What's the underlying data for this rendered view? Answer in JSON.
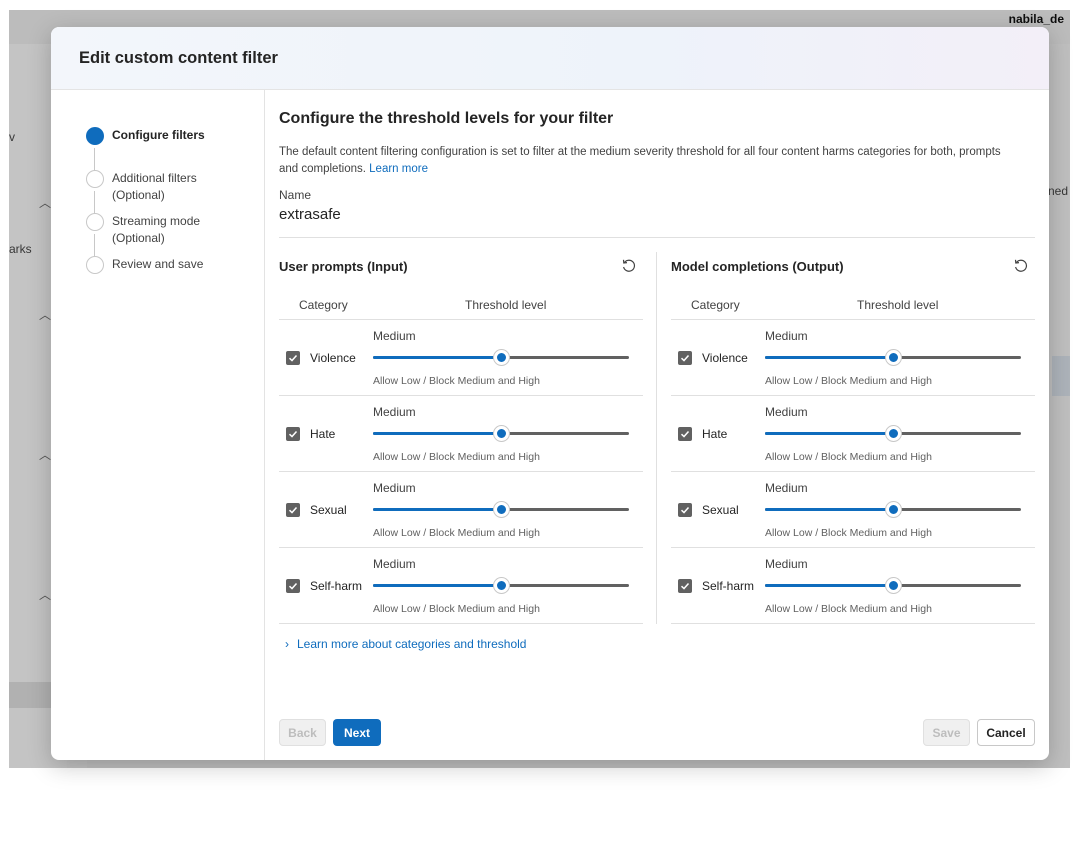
{
  "background": {
    "user": "nabila_de",
    "fragments": [
      "v",
      "arks",
      "ned"
    ]
  },
  "dialog": {
    "title": "Edit custom content filter"
  },
  "steps": [
    {
      "label": "Configure filters",
      "active": true
    },
    {
      "label": "Additional filters (Optional)",
      "active": false
    },
    {
      "label": "Streaming mode (Optional)",
      "active": false
    },
    {
      "label": "Review and save",
      "active": false
    }
  ],
  "main": {
    "heading": "Configure the threshold levels for your filter",
    "description": "The default content filtering configuration is set to filter at the medium severity threshold for all four content harms categories for both, prompts and completions.",
    "learn_more": "Learn more",
    "name_label": "Name",
    "name_value": "extrasafe",
    "more_link": "Learn more about categories and threshold"
  },
  "panels": [
    {
      "title": "User prompts (Input)",
      "col_category": "Category",
      "col_threshold": "Threshold level",
      "rows": [
        {
          "category": "Violence",
          "checked": true,
          "level": "Medium",
          "hint": "Allow Low / Block Medium and High",
          "value": 0.5
        },
        {
          "category": "Hate",
          "checked": true,
          "level": "Medium",
          "hint": "Allow Low / Block Medium and High",
          "value": 0.5
        },
        {
          "category": "Sexual",
          "checked": true,
          "level": "Medium",
          "hint": "Allow Low / Block Medium and High",
          "value": 0.5
        },
        {
          "category": "Self-harm",
          "checked": true,
          "level": "Medium",
          "hint": "Allow Low / Block Medium and High",
          "value": 0.5
        }
      ]
    },
    {
      "title": "Model completions (Output)",
      "col_category": "Category",
      "col_threshold": "Threshold level",
      "rows": [
        {
          "category": "Violence",
          "checked": true,
          "level": "Medium",
          "hint": "Allow Low / Block Medium and High",
          "value": 0.5
        },
        {
          "category": "Hate",
          "checked": true,
          "level": "Medium",
          "hint": "Allow Low / Block Medium and High",
          "value": 0.5
        },
        {
          "category": "Sexual",
          "checked": true,
          "level": "Medium",
          "hint": "Allow Low / Block Medium and High",
          "value": 0.5
        },
        {
          "category": "Self-harm",
          "checked": true,
          "level": "Medium",
          "hint": "Allow Low / Block Medium and High",
          "value": 0.5
        }
      ]
    }
  ],
  "buttons": {
    "back": "Back",
    "next": "Next",
    "save": "Save",
    "cancel": "Cancel"
  },
  "colors": {
    "accent": "#0f6cbd",
    "track": "#616161"
  }
}
